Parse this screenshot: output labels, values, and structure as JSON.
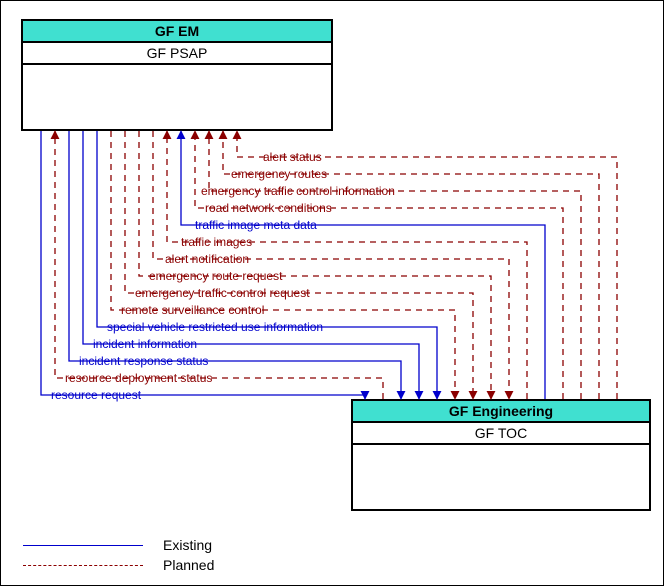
{
  "nodes": {
    "top": {
      "header": "GF EM",
      "title": "GF PSAP"
    },
    "bottom": {
      "header": "GF Engineering",
      "title": "GF TOC"
    }
  },
  "flows": [
    {
      "label": "resource request",
      "type": "existing",
      "dir": "to-bottom"
    },
    {
      "label": "resource deployment status",
      "type": "planned",
      "dir": "to-top"
    },
    {
      "label": "incident response status",
      "type": "existing",
      "dir": "to-bottom"
    },
    {
      "label": "incident information",
      "type": "existing",
      "dir": "to-bottom"
    },
    {
      "label": "special vehicle restricted use information",
      "type": "existing",
      "dir": "to-bottom"
    },
    {
      "label": "remote surveillance control",
      "type": "planned",
      "dir": "to-bottom"
    },
    {
      "label": "emergency traffic control request",
      "type": "planned",
      "dir": "to-bottom"
    },
    {
      "label": "emergency route request",
      "type": "planned",
      "dir": "to-bottom"
    },
    {
      "label": "alert notification",
      "type": "planned",
      "dir": "to-bottom"
    },
    {
      "label": "traffic images",
      "type": "planned",
      "dir": "to-top"
    },
    {
      "label": "traffic image meta data",
      "type": "existing",
      "dir": "to-top"
    },
    {
      "label": "road network conditions",
      "type": "planned",
      "dir": "to-top"
    },
    {
      "label": "emergency traffic control information",
      "type": "planned",
      "dir": "to-top"
    },
    {
      "label": "emergency routes",
      "type": "planned",
      "dir": "to-top"
    },
    {
      "label": "alert status",
      "type": "planned",
      "dir": "to-top"
    }
  ],
  "legend": {
    "existing": "Existing",
    "planned": "Planned"
  }
}
